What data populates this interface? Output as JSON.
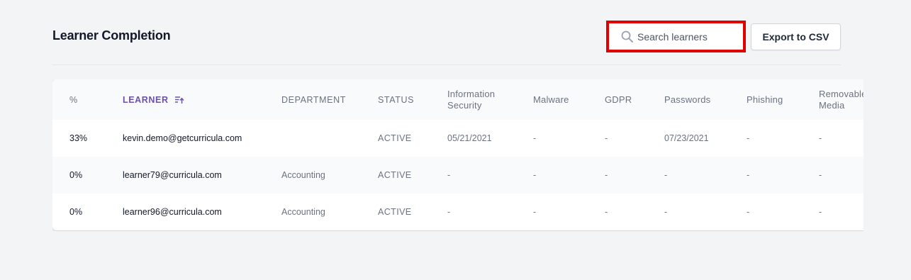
{
  "header": {
    "title": "Learner Completion",
    "search_placeholder": "Search learners",
    "search_value": "",
    "export_label": "Export to CSV"
  },
  "colors": {
    "accent": "#6b52a8",
    "highlight_border": "#e00000"
  },
  "table": {
    "columns": [
      {
        "label": "%"
      },
      {
        "label": "LEARNER",
        "sorted": "ascending"
      },
      {
        "label": "DEPARTMENT"
      },
      {
        "label": "STATUS"
      },
      {
        "label": "Information Security"
      },
      {
        "label": "Malware"
      },
      {
        "label": "GDPR"
      },
      {
        "label": "Passwords"
      },
      {
        "label": "Phishing"
      },
      {
        "label": "Removable Media"
      }
    ],
    "rows": [
      {
        "percent": "33%",
        "learner": "kevin.demo@getcurricula.com",
        "department": "",
        "status": "ACTIVE",
        "infosec": "05/21/2021",
        "malware": "-",
        "gdpr": "-",
        "passwords": "07/23/2021",
        "phishing": "-",
        "removable": "-"
      },
      {
        "percent": "0%",
        "learner": "learner79@curricula.com",
        "department": "Accounting",
        "status": "ACTIVE",
        "infosec": "-",
        "malware": "-",
        "gdpr": "-",
        "passwords": "-",
        "phishing": "-",
        "removable": "-"
      },
      {
        "percent": "0%",
        "learner": "learner96@curricula.com",
        "department": "Accounting",
        "status": "ACTIVE",
        "infosec": "-",
        "malware": "-",
        "gdpr": "-",
        "passwords": "-",
        "phishing": "-",
        "removable": "-"
      }
    ]
  }
}
